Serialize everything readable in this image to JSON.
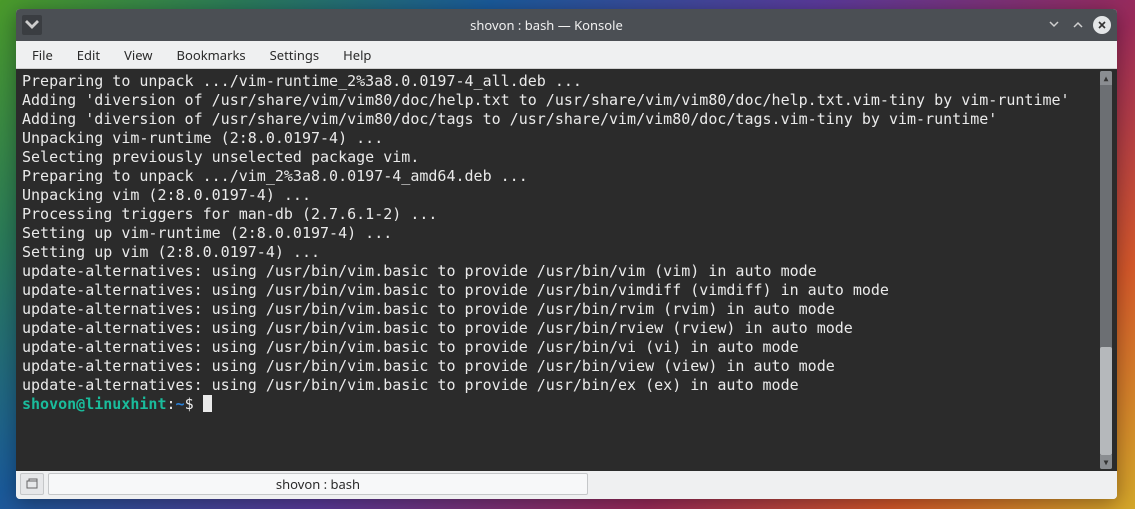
{
  "window": {
    "title": "shovon : bash — Konsole"
  },
  "menubar": {
    "items": [
      "File",
      "Edit",
      "View",
      "Bookmarks",
      "Settings",
      "Help"
    ]
  },
  "terminal": {
    "lines": [
      "Preparing to unpack .../vim-runtime_2%3a8.0.0197-4_all.deb ...",
      "Adding 'diversion of /usr/share/vim/vim80/doc/help.txt to /usr/share/vim/vim80/doc/help.txt.vim-tiny by vim-runtime'",
      "Adding 'diversion of /usr/share/vim/vim80/doc/tags to /usr/share/vim/vim80/doc/tags.vim-tiny by vim-runtime'",
      "Unpacking vim-runtime (2:8.0.0197-4) ...",
      "Selecting previously unselected package vim.",
      "Preparing to unpack .../vim_2%3a8.0.0197-4_amd64.deb ...",
      "Unpacking vim (2:8.0.0197-4) ...",
      "Processing triggers for man-db (2.7.6.1-2) ...",
      "Setting up vim-runtime (2:8.0.0197-4) ...",
      "Setting up vim (2:8.0.0197-4) ...",
      "update-alternatives: using /usr/bin/vim.basic to provide /usr/bin/vim (vim) in auto mode",
      "update-alternatives: using /usr/bin/vim.basic to provide /usr/bin/vimdiff (vimdiff) in auto mode",
      "update-alternatives: using /usr/bin/vim.basic to provide /usr/bin/rvim (rvim) in auto mode",
      "update-alternatives: using /usr/bin/vim.basic to provide /usr/bin/rview (rview) in auto mode",
      "update-alternatives: using /usr/bin/vim.basic to provide /usr/bin/vi (vi) in auto mode",
      "update-alternatives: using /usr/bin/vim.basic to provide /usr/bin/view (view) in auto mode",
      "update-alternatives: using /usr/bin/vim.basic to provide /usr/bin/ex (ex) in auto mode"
    ],
    "prompt": {
      "user_host": "shovon@linuxhint",
      "path": "~",
      "symbol": "$"
    }
  },
  "tabbar": {
    "tab_label": "shovon : bash"
  }
}
